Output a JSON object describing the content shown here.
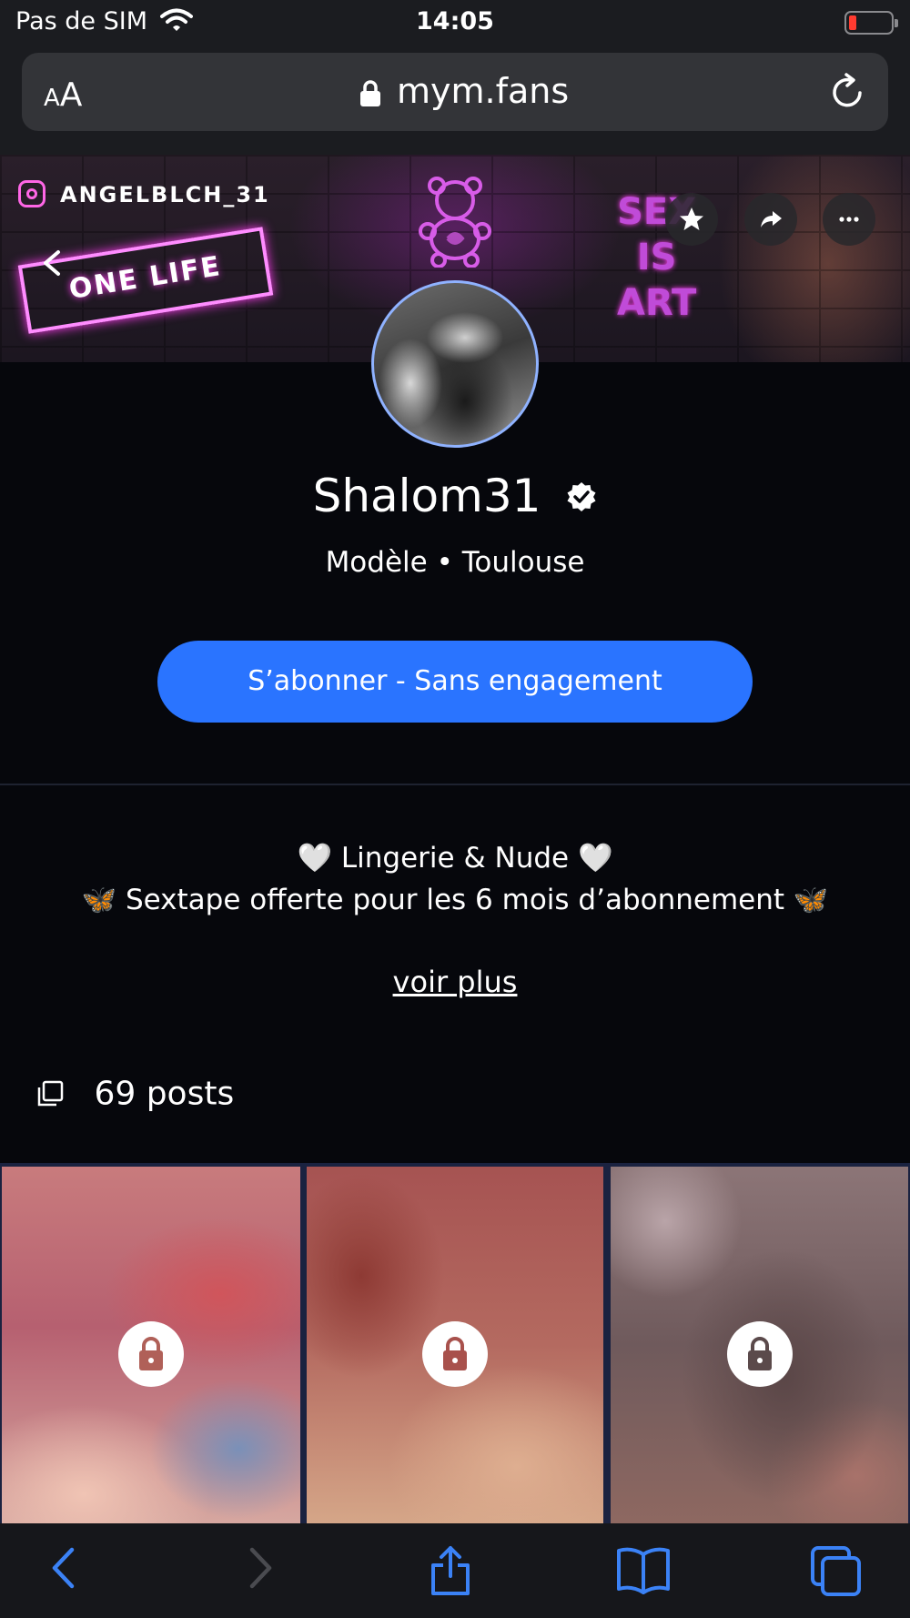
{
  "status_bar": {
    "carrier": "Pas de SIM",
    "time": "14:05"
  },
  "browser": {
    "text_size_small": "A",
    "text_size_large": "A",
    "host": "mym.fans"
  },
  "banner": {
    "instagram_handle": "ANGELBLCH_31",
    "sticker_text": "ONE LIFE",
    "neon_line1": "SEX",
    "neon_line2": "IS",
    "neon_line3": "ART"
  },
  "profile": {
    "name": "Shalom31",
    "subtitle": "Modèle • Toulouse",
    "subscribe_label": "S’abonner - Sans engagement",
    "bio_line1": "🤍 Lingerie & Nude 🤍",
    "bio_line2": "🦋 Sextape offerte pour les 6 mois d’abonnement 🦋",
    "see_more": "voir plus",
    "posts_count": "69 posts"
  },
  "colors": {
    "accent": "#2a74ff",
    "neon": "#ff3cf0",
    "background": "#06070c"
  },
  "icons": [
    "wifi-icon",
    "battery-icon",
    "lock-icon",
    "reload-icon",
    "instagram-icon",
    "back-icon",
    "star-icon",
    "share-icon",
    "more-icon",
    "verified-icon",
    "posts-icon",
    "lock-icon",
    "back-icon",
    "forward-icon",
    "share-icon",
    "bookmarks-icon",
    "tabs-icon"
  ]
}
